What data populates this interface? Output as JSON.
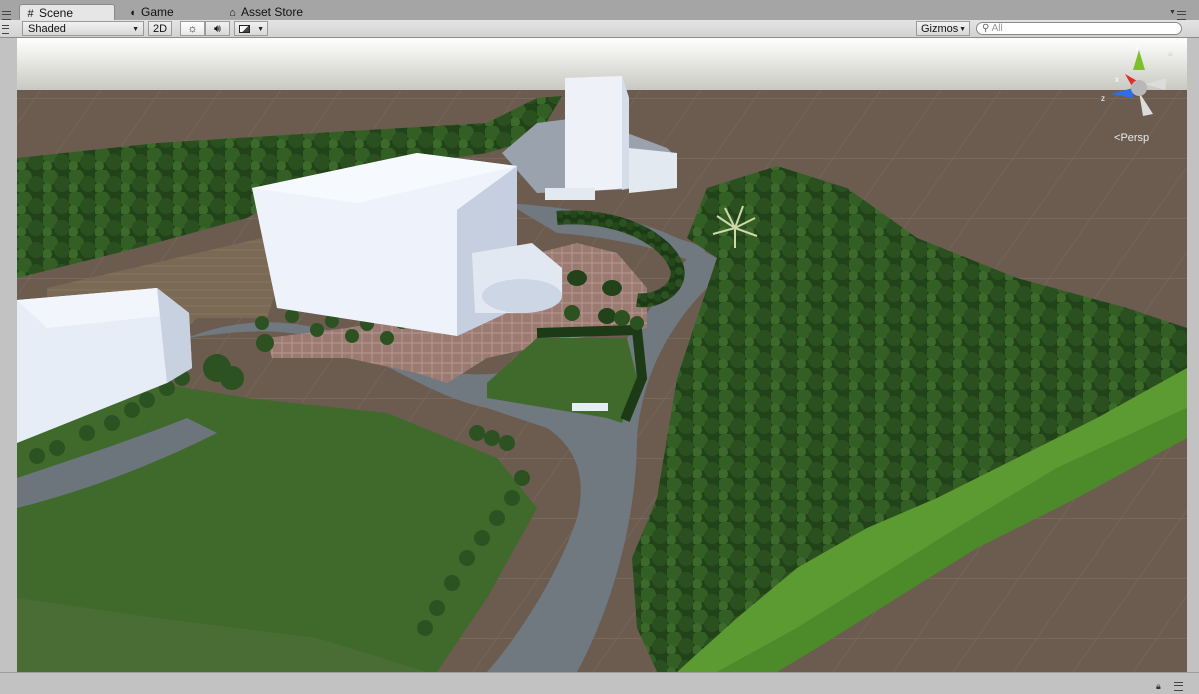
{
  "tabs": [
    {
      "label": "Scene",
      "icon": "grid-icon",
      "active": true
    },
    {
      "label": "Game",
      "icon": "pacman-icon",
      "active": false
    },
    {
      "label": "Asset Store",
      "icon": "store-icon",
      "active": false
    }
  ],
  "toolbar": {
    "shading_mode": "Shaded",
    "mode_2d": "2D",
    "gizmos_label": "Gizmos",
    "search_placeholder": "All"
  },
  "scene_gizmo": {
    "projection_label": "Persp",
    "axes": [
      "x",
      "y",
      "z"
    ]
  },
  "colors": {
    "ground": "#6b5c4f",
    "grass": "#3f6a2c",
    "road": "#707880",
    "buildings": "#e6edf7",
    "trees": "#2a4d1e"
  }
}
